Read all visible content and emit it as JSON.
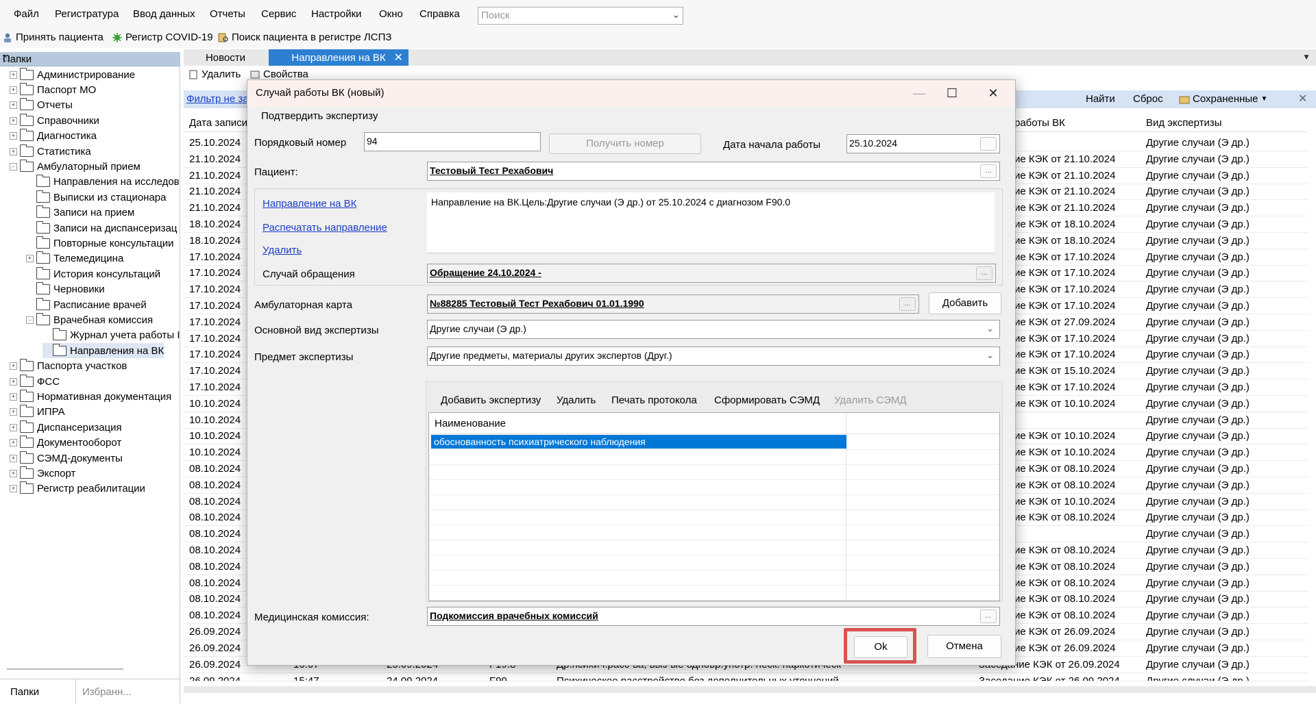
{
  "menu": [
    "Файл",
    "Регистратура",
    "Ввод данных",
    "Отчеты",
    "Сервис",
    "Настройки",
    "Окно",
    "Справка"
  ],
  "search": {
    "placeholder": "Поиск"
  },
  "toolbar": {
    "accept": "Принять пациента",
    "covid": "Регистр COVID-19",
    "search_lspz": "Поиск пациента в регистре ЛСПЗ"
  },
  "left_panel": {
    "title": "Папки",
    "tree": [
      {
        "label": "Администрирование",
        "level": 0,
        "expand": "+"
      },
      {
        "label": "Паспорт МО",
        "level": 0,
        "expand": "+"
      },
      {
        "label": "Отчеты",
        "level": 0,
        "expand": "+"
      },
      {
        "label": "Справочники",
        "level": 0,
        "expand": "+"
      },
      {
        "label": "Диагностика",
        "level": 0,
        "expand": "+"
      },
      {
        "label": "Статистика",
        "level": 0,
        "expand": "+"
      },
      {
        "label": "Амбулаторный прием",
        "level": 0,
        "expand": "-"
      },
      {
        "label": "Направления на исследов",
        "level": 1,
        "expand": ""
      },
      {
        "label": "Выписки из стационара",
        "level": 1,
        "expand": ""
      },
      {
        "label": "Записи на прием",
        "level": 1,
        "expand": ""
      },
      {
        "label": "Записи на диспансеризац",
        "level": 1,
        "expand": ""
      },
      {
        "label": "Повторные консультации",
        "level": 1,
        "expand": ""
      },
      {
        "label": "Телемедицина",
        "level": 1,
        "expand": "+"
      },
      {
        "label": "История консультаций",
        "level": 1,
        "expand": ""
      },
      {
        "label": "Черновики",
        "level": 1,
        "expand": ""
      },
      {
        "label": "Расписание врачей",
        "level": 1,
        "expand": ""
      },
      {
        "label": "Врачебная комиссия",
        "level": 1,
        "expand": "-"
      },
      {
        "label": "Журнал учета работы I",
        "level": 2,
        "expand": ""
      },
      {
        "label": "Направления на ВК",
        "level": 2,
        "expand": ""
      },
      {
        "label": "Паспорта участков",
        "level": 0,
        "expand": "+"
      },
      {
        "label": "ФСС",
        "level": 0,
        "expand": "+"
      },
      {
        "label": "Нормативная документация",
        "level": 0,
        "expand": "+"
      },
      {
        "label": "ИПРА",
        "level": 0,
        "expand": "+"
      },
      {
        "label": "Диспансеризация",
        "level": 0,
        "expand": "+"
      },
      {
        "label": "Документооборот",
        "level": 0,
        "expand": "+"
      },
      {
        "label": "СЭМД-документы",
        "level": 0,
        "expand": "+"
      },
      {
        "label": "Экспорт",
        "level": 0,
        "expand": "+"
      },
      {
        "label": "Регистр реабилитации",
        "level": 0,
        "expand": "+"
      }
    ],
    "bottom_tabs": [
      "Папки",
      "Избранн..."
    ]
  },
  "tabs": [
    "Новости",
    "Направления на ВК"
  ],
  "content": {
    "toolbar_delete": "Удалить",
    "toolbar_props": "Свойства",
    "filter": "Фильтр не за",
    "find": "Найти",
    "reset": "Сброс",
    "saved": "Сохраненные",
    "col_date": "Дата записи",
    "col_work": "работы ВК",
    "col_type": "Вид экспертизы",
    "rows": [
      {
        "date": "25.10.2024",
        "mid": "",
        "type": "Другие случаи (Э др.)"
      },
      {
        "date": "21.10.2024",
        "mid": "ие КЭК от 21.10.2024",
        "type": "Другие случаи (Э др.)"
      },
      {
        "date": "21.10.2024",
        "mid": "ие КЭК от 21.10.2024",
        "type": "Другие случаи (Э др.)"
      },
      {
        "date": "21.10.2024",
        "mid": "ие КЭК от 21.10.2024",
        "type": "Другие случаи (Э др.)"
      },
      {
        "date": "21.10.2024",
        "mid": "ие КЭК от 21.10.2024",
        "type": "Другие случаи (Э др.)"
      },
      {
        "date": "18.10.2024",
        "mid": "ие КЭК от 18.10.2024",
        "type": "Другие случаи (Э др.)"
      },
      {
        "date": "18.10.2024",
        "mid": "ие КЭК от 18.10.2024",
        "type": "Другие случаи (Э др.)"
      },
      {
        "date": "17.10.2024",
        "mid": "ие КЭК от 17.10.2024",
        "type": "Другие случаи (Э др.)"
      },
      {
        "date": "17.10.2024",
        "mid": "ие КЭК от 17.10.2024",
        "type": "Другие случаи (Э др.)"
      },
      {
        "date": "17.10.2024",
        "mid": "ие КЭК от 17.10.2024",
        "type": "Другие случаи (Э др.)"
      },
      {
        "date": "17.10.2024",
        "mid": "ие КЭК от 17.10.2024",
        "type": "Другие случаи (Э др.)"
      },
      {
        "date": "17.10.2024",
        "mid": "ие КЭК от 27.09.2024",
        "type": "Другие случаи (Э др.)"
      },
      {
        "date": "17.10.2024",
        "mid": "ие КЭК от 17.10.2024",
        "type": "Другие случаи (Э др.)"
      },
      {
        "date": "17.10.2024",
        "mid": "ие КЭК от 17.10.2024",
        "type": "Другие случаи (Э др.)"
      },
      {
        "date": "17.10.2024",
        "mid": "ие КЭК от 15.10.2024",
        "type": "Другие случаи (Э др.)"
      },
      {
        "date": "17.10.2024",
        "mid": "ие КЭК от 17.10.2024",
        "type": "Другие случаи (Э др.)"
      },
      {
        "date": "10.10.2024",
        "mid": "ие КЭК от 10.10.2024",
        "type": "Другие случаи (Э др.)"
      },
      {
        "date": "10.10.2024",
        "mid": "",
        "type": "Другие случаи (Э др.)"
      },
      {
        "date": "10.10.2024",
        "mid": "ие КЭК от 10.10.2024",
        "type": "Другие случаи (Э др.)"
      },
      {
        "date": "10.10.2024",
        "mid": "ие КЭК от 10.10.2024",
        "type": "Другие случаи (Э др.)"
      },
      {
        "date": "08.10.2024",
        "mid": "ие КЭК от 08.10.2024",
        "type": "Другие случаи (Э др.)"
      },
      {
        "date": "08.10.2024",
        "mid": "ие КЭК от 08.10.2024",
        "type": "Другие случаи (Э др.)"
      },
      {
        "date": "08.10.2024",
        "mid": "ие КЭК от 10.10.2024",
        "type": "Другие случаи (Э др.)"
      },
      {
        "date": "08.10.2024",
        "mid": "ие КЭК от 08.10.2024",
        "type": "Другие случаи (Э др.)"
      },
      {
        "date": "08.10.2024",
        "mid": "",
        "type": "Другие случаи (Э др.)"
      },
      {
        "date": "08.10.2024",
        "mid": "ие КЭК от 08.10.2024",
        "type": "Другие случаи (Э др.)"
      },
      {
        "date": "08.10.2024",
        "mid": "ие КЭК от 08.10.2024",
        "type": "Другие случаи (Э др.)"
      },
      {
        "date": "08.10.2024",
        "mid": "ие КЭК от 08.10.2024",
        "type": "Другие случаи (Э др.)"
      },
      {
        "date": "08.10.2024",
        "mid": "ие КЭК от 08.10.2024",
        "type": "Другие случаи (Э др.)"
      },
      {
        "date": "08.10.2024",
        "mid": "ие КЭК от 08.10.2024",
        "type": "Другие случаи (Э др.)"
      },
      {
        "date": "26.09.2024",
        "mid": "ие КЭК от 26.09.2024",
        "type": "Другие случаи (Э др.)"
      },
      {
        "date": "26.09.2024",
        "mid": "ие КЭК от 26.09.2024",
        "type": "Другие случаи (Э др.)"
      }
    ],
    "row_a": {
      "date": "26.09.2024",
      "time": "16:07",
      "d2": "25.09.2024",
      "code": "F19.8",
      "text": "Др.психич.расс-ва, выз-ые одновр.употр. неск. наркотическ",
      "mid": "Заседание КЭК от 26.09.2024",
      "type": "Другие случаи (Э др.)"
    },
    "row_b": {
      "date": "26.09.2024",
      "time": "15:47",
      "d2": "24.09.2024",
      "code": "F99",
      "text": "Психическое расстройство без дополнительных уточнений",
      "mid": "Заседание КЭК от 26.09.2024",
      "type": "Другие случаи (Э др.)"
    }
  },
  "dialog": {
    "title": "Случай работы ВК (новый)",
    "confirm": "Подтвердить экспертизу",
    "num_label": "Порядковый номер",
    "num_value": "94",
    "get_num": "Получить номер",
    "start_label": "Дата начала работы",
    "start_value": "25.10.2024",
    "patient_label": "Пациент:",
    "patient_value": "Тестовый Тест Рехабович",
    "link_direction": "Направление на ВК",
    "link_print": "Распечатать направление",
    "link_delete": "Удалить",
    "direction_text": "Направление на ВК.Цель:Другие случаи (Э др.) от 25.10.2024 с диагнозом F90.0",
    "case_label": "Случай обращения",
    "case_value": "Обращение 24.10.2024 -",
    "card_label": "Амбулаторная карта",
    "card_value": "№88285 Тестовый Тест Рехабович 01.01.1990",
    "add": "Добавить",
    "main_type_label": "Основной вид экспертизы",
    "main_type_value": "Другие случаи (Э др.)",
    "subject_label": "Предмет экспертизы",
    "subject_value": "Другие предметы, материалы других экспертов (Друг.)",
    "exp_toolbar": [
      "Добавить экспертизу",
      "Удалить",
      "Печать протокола",
      "Сформировать СЭМД",
      "Удалить СЭМД"
    ],
    "grid_header": "Наименование",
    "grid_selected": "обоснованность психиатрического наблюдения",
    "commission_label": "Медицинская комиссия:",
    "commission_value": "Подкомиссия врачебных комиссий",
    "ok": "Ok",
    "cancel": "Отмена"
  },
  "colors": {
    "highlight": "#d9534f",
    "selection": "#0078d7",
    "link": "#1a3fc4"
  }
}
